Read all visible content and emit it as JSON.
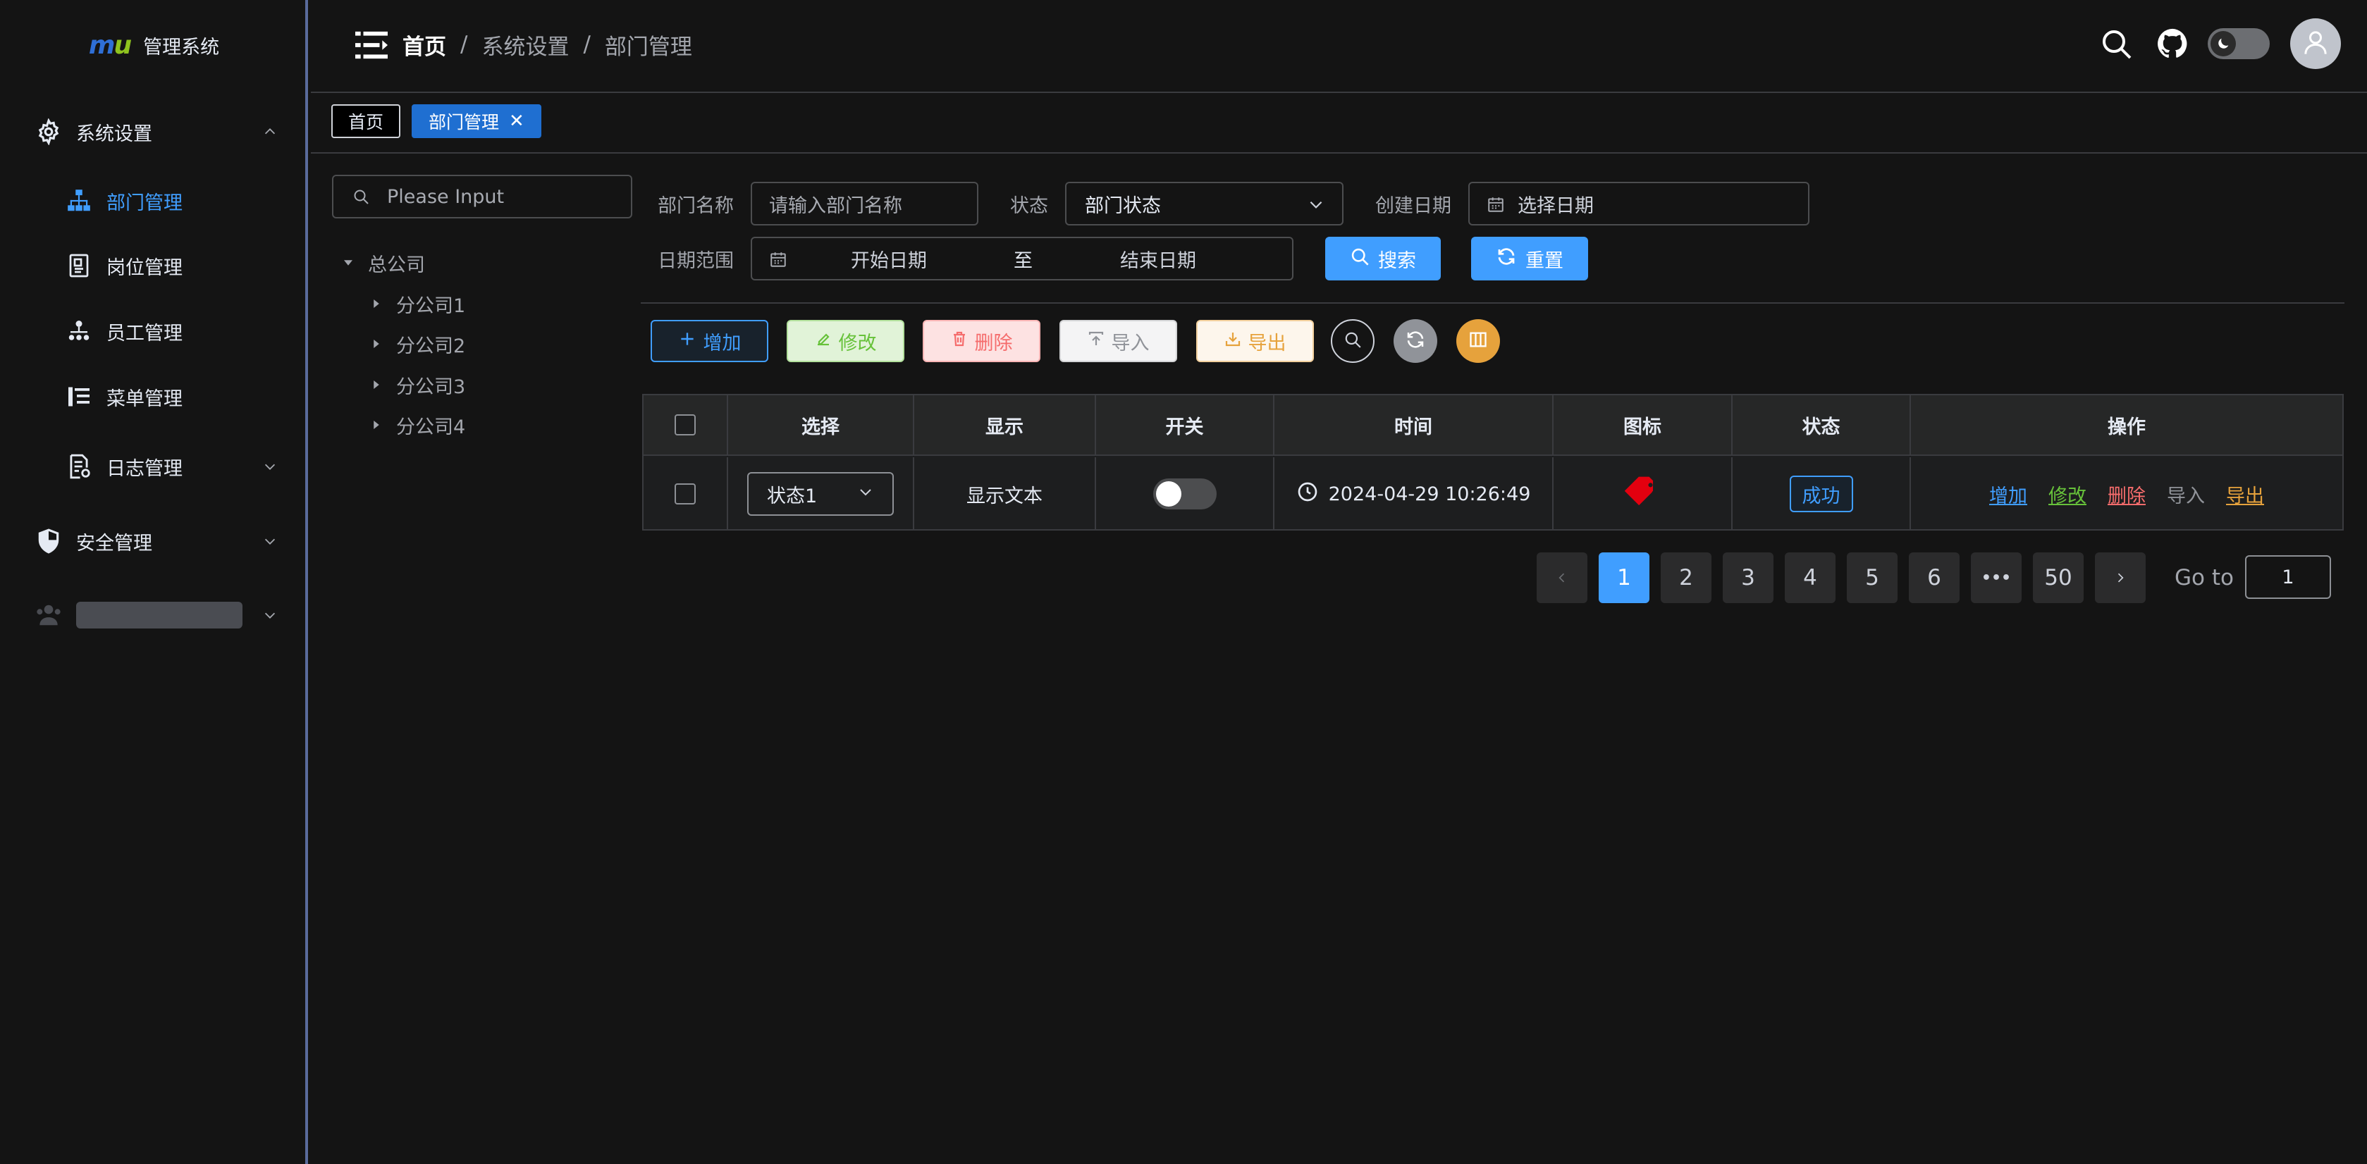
{
  "app": {
    "logo_m": "m",
    "logo_u": "u",
    "title": "管理系统"
  },
  "sidebar": {
    "groups": [
      {
        "label": "系统设置",
        "icon": "gear-icon",
        "expanded": true
      },
      {
        "label": "安全管理",
        "icon": "shield-icon",
        "expanded": false
      }
    ],
    "items": [
      {
        "label": "部门管理",
        "icon": "org-chart-icon",
        "active": true
      },
      {
        "label": "岗位管理",
        "icon": "id-badge-icon",
        "active": false
      },
      {
        "label": "员工管理",
        "icon": "team-tree-icon",
        "active": false
      },
      {
        "label": "菜单管理",
        "icon": "menu-list-icon",
        "active": false
      },
      {
        "label": "日志管理",
        "icon": "log-doc-icon",
        "active": false
      }
    ],
    "user_group_icon": "users-icon"
  },
  "header": {
    "breadcrumb": {
      "home": "首页",
      "sep": "/",
      "level1": "系统设置",
      "level2": "部门管理"
    },
    "icons": [
      "search-icon",
      "github-icon",
      "moon-icon",
      "user-icon"
    ]
  },
  "tags": {
    "home": "首页",
    "active": "部门管理",
    "close": "✕"
  },
  "tree": {
    "search_placeholder": "Please Input",
    "root": "总公司",
    "children": [
      "分公司1",
      "分公司2",
      "分公司3",
      "分公司4"
    ]
  },
  "search_form": {
    "dept_name_label": "部门名称",
    "dept_name_placeholder": "请输入部门名称",
    "status_label": "状态",
    "status_placeholder": "部门状态",
    "create_date_label": "创建日期",
    "create_date_placeholder": "选择日期",
    "date_range_label": "日期范围",
    "start_placeholder": "开始日期",
    "range_sep": "至",
    "end_placeholder": "结束日期",
    "search_btn": "搜索",
    "reset_btn": "重置"
  },
  "toolbar": {
    "add": "增加",
    "edit": "修改",
    "delete": "删除",
    "import": "导入",
    "export": "导出"
  },
  "table": {
    "headers": [
      "选择",
      "显示",
      "开关",
      "时间",
      "图标",
      "状态",
      "操作"
    ],
    "rows": [
      {
        "select": "状态1",
        "display": "显示文本",
        "switch_on": false,
        "time": "2024-04-29 10:26:49",
        "icon": "price-tag-icon",
        "status": "成功",
        "ops": {
          "add": "增加",
          "edit": "修改",
          "delete": "删除",
          "import": "导入",
          "export": "导出"
        }
      }
    ]
  },
  "pagination": {
    "pages": [
      "1",
      "2",
      "3",
      "4",
      "5",
      "6",
      "•••",
      "50"
    ],
    "current": "1",
    "goto_label": "Go to",
    "goto_value": "1"
  },
  "colors": {
    "primary": "#409eff",
    "success": "#67c23a",
    "danger": "#f56c6c",
    "info": "#909399",
    "warning": "#e6a23c"
  }
}
